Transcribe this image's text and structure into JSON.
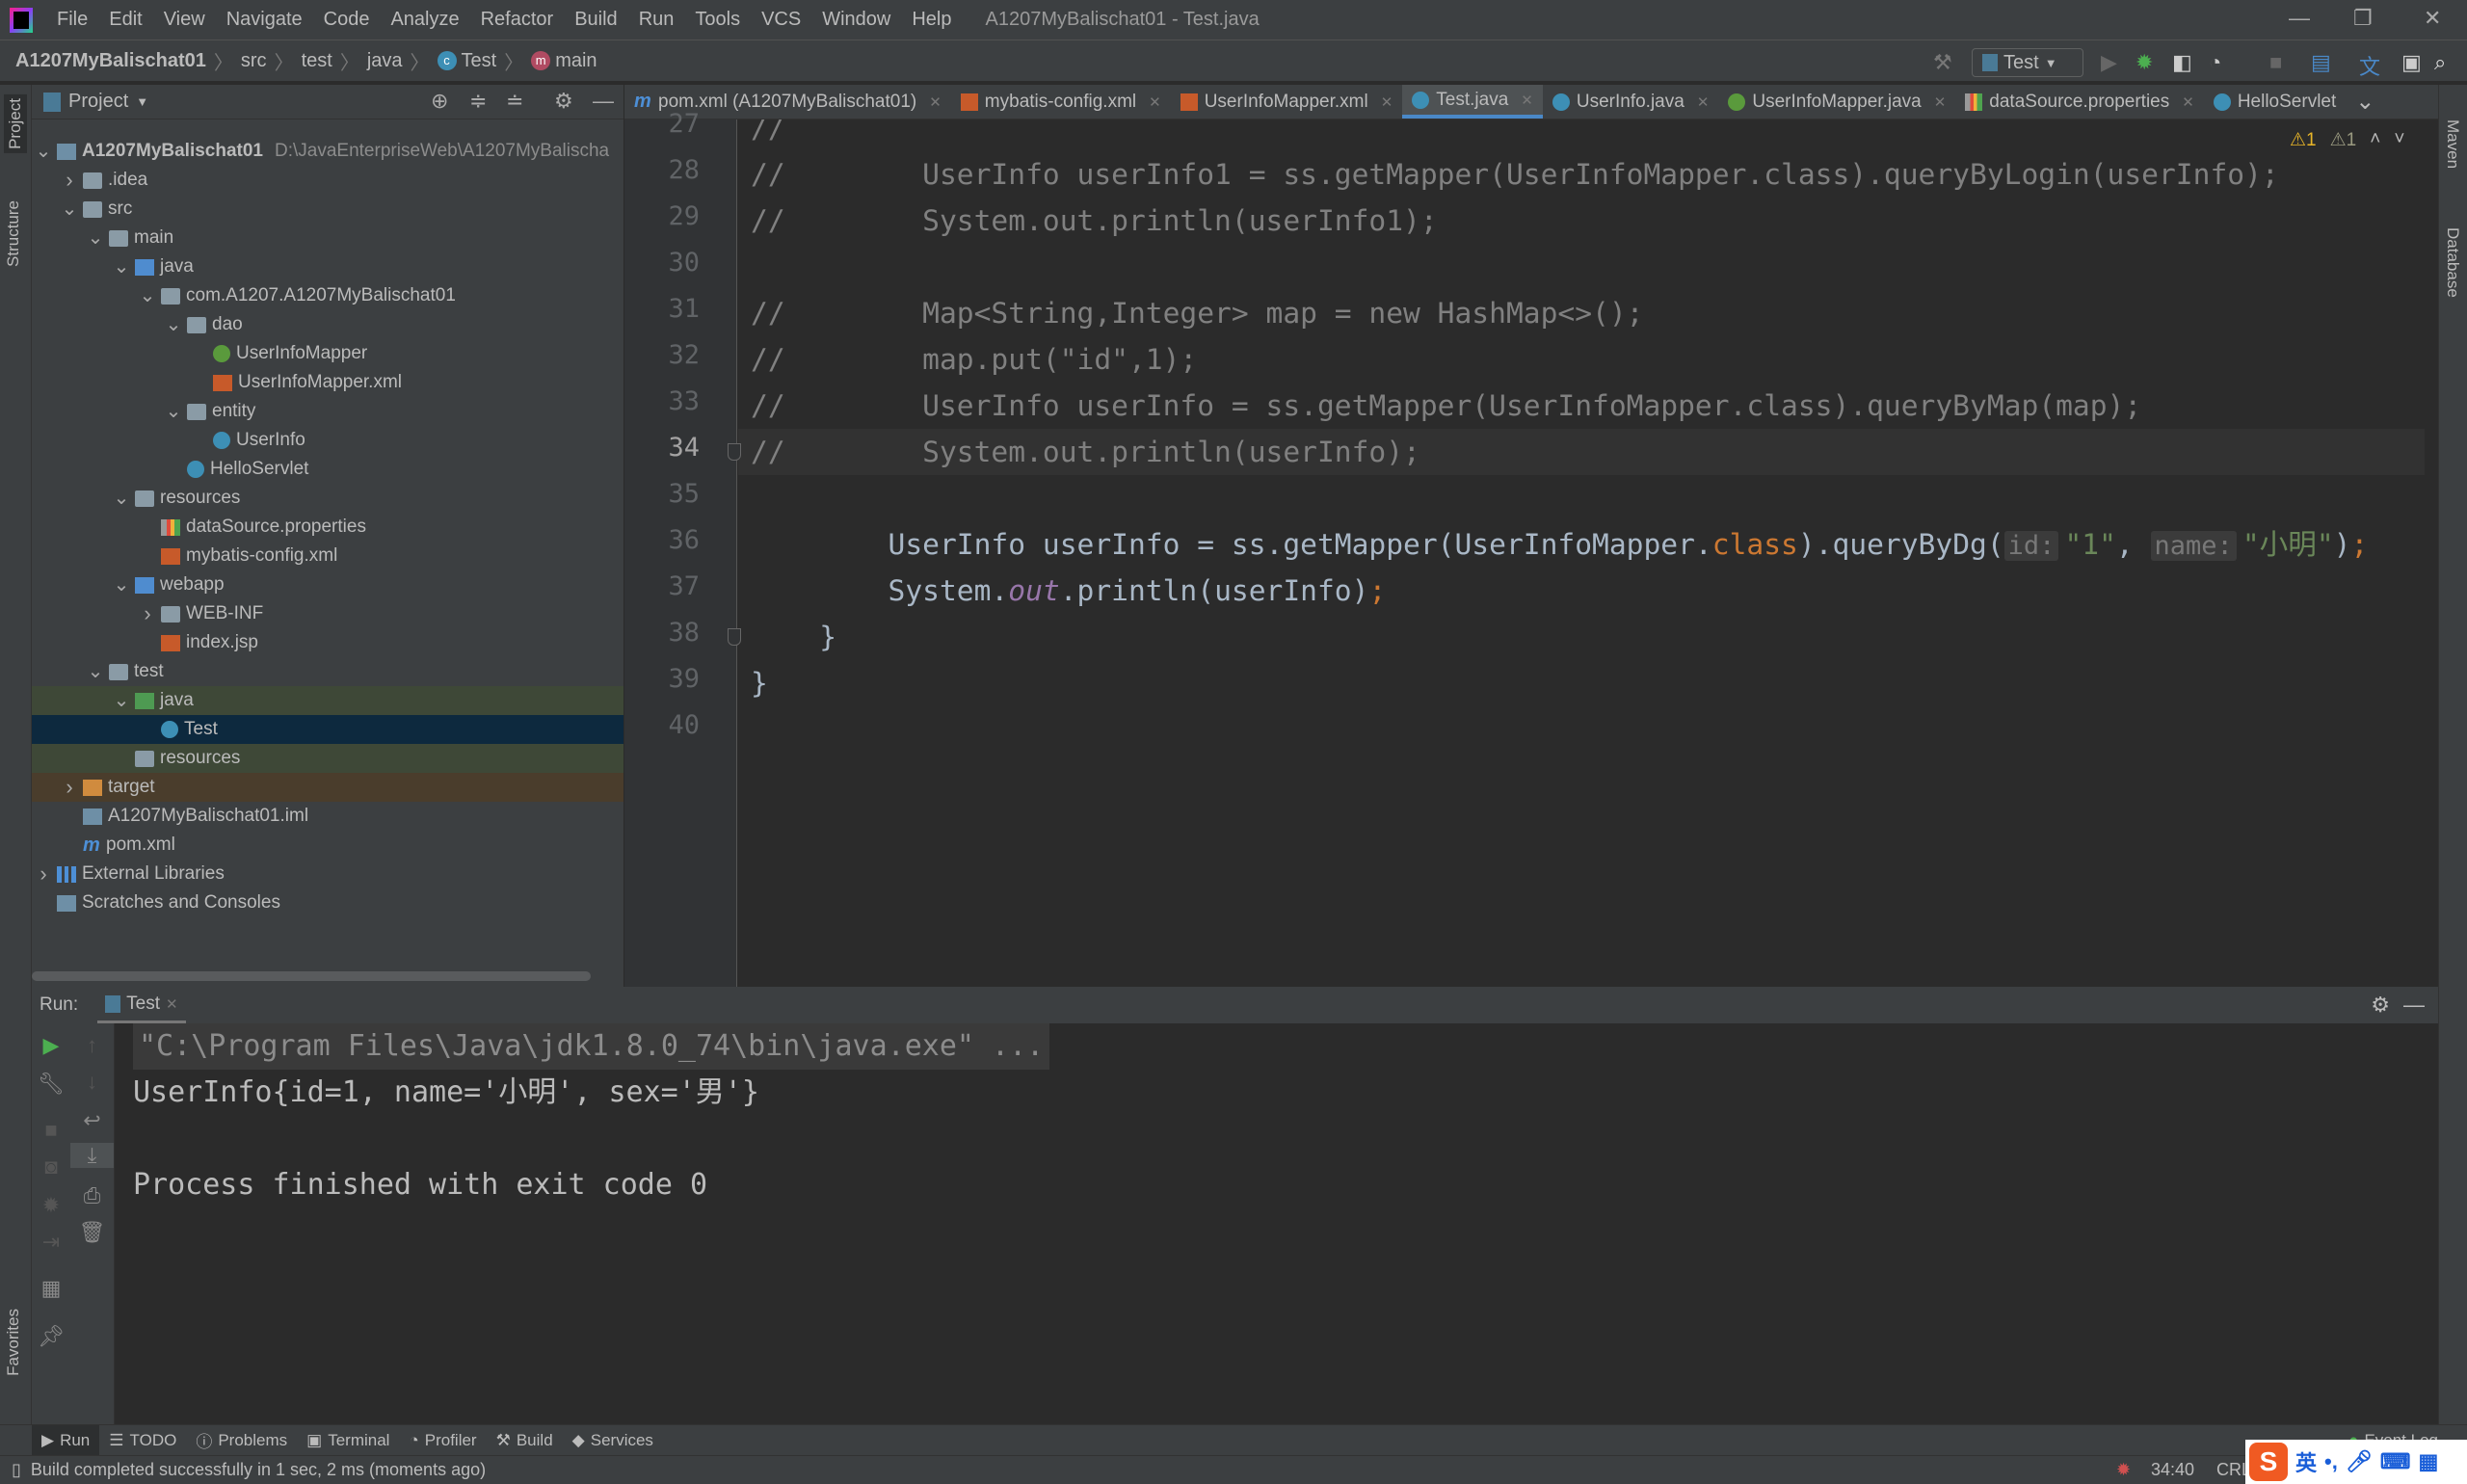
{
  "app": {
    "window_title": "A1207MyBalischat01 - Test.java",
    "menu": [
      "File",
      "Edit",
      "View",
      "Navigate",
      "Code",
      "Analyze",
      "Refactor",
      "Build",
      "Run",
      "Tools",
      "VCS",
      "Window",
      "Help"
    ]
  },
  "breadcrumb": [
    "A1207MyBalischat01",
    "src",
    "test",
    "java",
    "Test",
    "main"
  ],
  "toolbar": {
    "run_config": "Test"
  },
  "stripes": {
    "left": [
      "Project",
      "Structure",
      "Favorites"
    ],
    "right": [
      "Maven",
      "Database"
    ]
  },
  "project": {
    "title": "Project",
    "tree": [
      {
        "d": 0,
        "c": "open",
        "i": "mod",
        "l": "A1207MyBalischat01",
        "x": "D:\\JavaEnterpriseWeb\\A1207MyBalischa",
        "b": true
      },
      {
        "d": 1,
        "c": "closed",
        "i": "folder",
        "l": ".idea"
      },
      {
        "d": 1,
        "c": "open",
        "i": "folder",
        "l": "src"
      },
      {
        "d": 2,
        "c": "open",
        "i": "folder",
        "l": "main"
      },
      {
        "d": 3,
        "c": "open",
        "i": "bfolder",
        "l": "java"
      },
      {
        "d": 4,
        "c": "open",
        "i": "pkg",
        "l": "com.A1207.A1207MyBalischat01"
      },
      {
        "d": 5,
        "c": "open",
        "i": "pkg",
        "l": "dao"
      },
      {
        "d": 6,
        "c": "",
        "i": "ifc",
        "l": "UserInfoMapper"
      },
      {
        "d": 6,
        "c": "",
        "i": "xml",
        "l": "UserInfoMapper.xml"
      },
      {
        "d": 5,
        "c": "open",
        "i": "pkg",
        "l": "entity"
      },
      {
        "d": 6,
        "c": "",
        "i": "cls",
        "l": "UserInfo"
      },
      {
        "d": 5,
        "c": "",
        "i": "cls",
        "l": "HelloServlet"
      },
      {
        "d": 3,
        "c": "open",
        "i": "folder",
        "l": "resources"
      },
      {
        "d": 4,
        "c": "",
        "i": "prop",
        "l": "dataSource.properties"
      },
      {
        "d": 4,
        "c": "",
        "i": "xml",
        "l": "mybatis-config.xml"
      },
      {
        "d": 3,
        "c": "open",
        "i": "bfolder",
        "l": "webapp"
      },
      {
        "d": 4,
        "c": "closed",
        "i": "folder",
        "l": "WEB-INF"
      },
      {
        "d": 4,
        "c": "",
        "i": "xml",
        "l": "index.jsp"
      },
      {
        "d": 2,
        "c": "open",
        "i": "folder",
        "l": "test"
      },
      {
        "d": 3,
        "c": "open",
        "i": "gfolder",
        "l": "java",
        "h": "olive"
      },
      {
        "d": 4,
        "c": "",
        "i": "cls",
        "l": "Test",
        "h": "sel"
      },
      {
        "d": 3,
        "c": "",
        "i": "folder",
        "l": "resources",
        "h": "olive"
      },
      {
        "d": 1,
        "c": "closed",
        "i": "ofolder",
        "l": "target",
        "h": "brown"
      },
      {
        "d": 1,
        "c": "",
        "i": "mod",
        "l": "A1207MyBalischat01.iml"
      },
      {
        "d": 1,
        "c": "",
        "i": "mvn",
        "l": "pom.xml"
      },
      {
        "d": 0,
        "c": "closed",
        "i": "lib",
        "l": "External Libraries"
      },
      {
        "d": 0,
        "c": "",
        "i": "scr",
        "l": "Scratches and Consoles"
      }
    ]
  },
  "tabs": [
    {
      "label": "pom.xml (A1207MyBalischat01)",
      "icon": "maven-icon"
    },
    {
      "label": "mybatis-config.xml",
      "icon": "xml-icon"
    },
    {
      "label": "UserInfoMapper.xml",
      "icon": "xml-icon"
    },
    {
      "label": "Test.java",
      "icon": "class-icon",
      "active": true
    },
    {
      "label": "UserInfo.java",
      "icon": "class-icon"
    },
    {
      "label": "UserInfoMapper.java",
      "icon": "interface-icon"
    },
    {
      "label": "dataSource.properties",
      "icon": "properties-icon"
    },
    {
      "label": "HelloServlet",
      "icon": "class-icon"
    }
  ],
  "editor": {
    "warnings": "1",
    "weak_warnings": "1",
    "current_line": 34,
    "lines": [
      {
        "n": 27,
        "t": [
          [
            "cm",
            "//"
          ]
        ]
      },
      {
        "n": 28,
        "t": [
          [
            "cm",
            "//        UserInfo userInfo1 = ss.getMapper(UserInfoMapper.class).queryByLogin(userInfo);"
          ]
        ]
      },
      {
        "n": 29,
        "t": [
          [
            "cm",
            "//        System.out.println(userInfo1);"
          ]
        ]
      },
      {
        "n": 30,
        "t": []
      },
      {
        "n": 31,
        "t": [
          [
            "cm",
            "//        Map<String,Integer> map = new HashMap<>();"
          ]
        ]
      },
      {
        "n": 32,
        "t": [
          [
            "cm",
            "//        map.put(\"id\",1);"
          ]
        ]
      },
      {
        "n": 33,
        "t": [
          [
            "cm",
            "//        UserInfo userInfo = ss.getMapper(UserInfoMapper.class).queryByMap(map);"
          ]
        ]
      },
      {
        "n": 34,
        "t": [
          [
            "cm",
            "//        System.out.println(userInfo);"
          ]
        ]
      },
      {
        "n": 35,
        "t": []
      },
      {
        "n": 36,
        "t": [
          [
            "",
            "        UserInfo userInfo = ss.getMapper(UserInfoMapper."
          ],
          [
            "kw",
            "class"
          ],
          [
            "",
            ").queryByDg("
          ],
          [
            "hint",
            "id:"
          ],
          [
            "st",
            "\"1\""
          ],
          [
            "",
            ", "
          ],
          [
            "hint",
            "name:"
          ],
          [
            "st",
            "\"小明\""
          ],
          [
            "",
            ")"
          ],
          [
            "kw",
            ";"
          ]
        ]
      },
      {
        "n": 37,
        "t": [
          [
            "",
            "        System."
          ],
          [
            "sf",
            "out"
          ],
          [
            "",
            ".println(userInfo)"
          ],
          [
            "kw",
            ";"
          ]
        ]
      },
      {
        "n": 38,
        "t": [
          [
            "",
            "    }"
          ]
        ]
      },
      {
        "n": 39,
        "t": [
          [
            "",
            "}"
          ]
        ]
      },
      {
        "n": 40,
        "t": []
      }
    ]
  },
  "run": {
    "label": "Run:",
    "tab": "Test",
    "console": [
      "\"C:\\Program Files\\Java\\jdk1.8.0_74\\bin\\java.exe\" ...",
      "UserInfo{id=1, name='小明', sex='男'}",
      "",
      "Process finished with exit code 0"
    ]
  },
  "bottom_tools": [
    "Run",
    "TODO",
    "Problems",
    "Terminal",
    "Profiler",
    "Build",
    "Services"
  ],
  "event_log": "Event Log",
  "status": {
    "message": "Build completed successfully in 1 sec, 2 ms (moments ago)",
    "position": "34:40",
    "line_sep": "CRL"
  },
  "ime": {
    "lang": "英"
  }
}
